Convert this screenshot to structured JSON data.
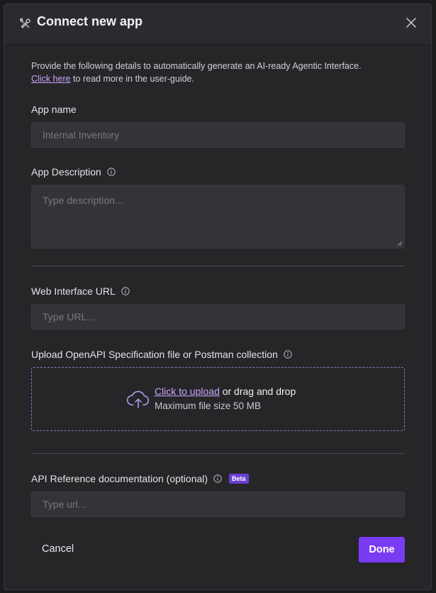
{
  "header": {
    "title": "Connect new app",
    "icon": "tools-icon",
    "close_icon": "close-icon"
  },
  "intro": {
    "text_before_link": "Provide the following details to automatically generate an AI-ready Agentic Interface.",
    "link_text": "Click here",
    "text_after_link": " to read more in the user-guide."
  },
  "app_name": {
    "label": "App name",
    "placeholder": "Internal Inventory"
  },
  "app_description": {
    "label": "App Description",
    "placeholder": "Type description..."
  },
  "web_interface_url": {
    "label": "Web Interface URL",
    "placeholder": "Type URL..."
  },
  "upload": {
    "label": "Upload OpenAPI Specification file or Postman collection",
    "link_text": "Click to upload",
    "text_after_link": " or drag and drop",
    "max_size_text": "Maximum file size 50 MB",
    "icon": "cloud-upload-icon"
  },
  "api_reference": {
    "label": "API Reference documentation (optional)",
    "badge": "Beta",
    "placeholder": "Type url..."
  },
  "footer": {
    "cancel_label": "Cancel",
    "done_label": "Done"
  },
  "colors": {
    "accent": "#7a3cf2",
    "link": "#c9a8ff",
    "background": "#262629"
  }
}
